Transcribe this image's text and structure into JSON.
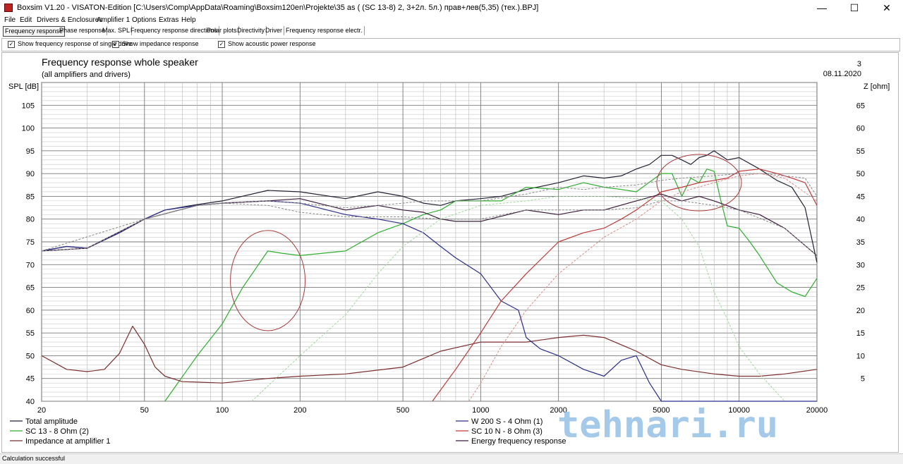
{
  "window": {
    "title": "Boxsim V1.20 - VISATON-Edition [C:\\Users\\Comp\\AppData\\Roaming\\Boxsim120en\\Projekte\\35 as (  (SC 13-8)  2, 3+2л. 5л.)  прав+лев(5,35) (тех.).BPJ]",
    "minimize": "—",
    "maximize": "☐",
    "close": "✕"
  },
  "menu": [
    "File",
    "Edit",
    "Drivers & Enclosures",
    "Amplifier 1",
    "Options",
    "Extras",
    "Help"
  ],
  "tabs": [
    {
      "label": "Frequency response",
      "active": true
    },
    {
      "label": "Phase response",
      "active": false
    },
    {
      "label": "Max. SPL",
      "active": false
    },
    {
      "label": "Frequency response directions",
      "active": false
    },
    {
      "label": "Polar plots",
      "active": false
    },
    {
      "label": "Directivity",
      "active": false
    },
    {
      "label": "Driver",
      "active": false
    },
    {
      "label": "Frequency response electr.",
      "active": false
    }
  ],
  "options": [
    {
      "label": "Show frequency response of single drive",
      "checked": true
    },
    {
      "label": "Show impedance response",
      "checked": true
    },
    {
      "label": "Show acoustic power response",
      "checked": true
    }
  ],
  "status": "Calculation successful",
  "watermark": "tehnari.ru",
  "chart_data": {
    "type": "line",
    "title": "Frequency response whole speaker",
    "subtitle": "(all amplifiers and drivers)",
    "corner_number": "3",
    "date": "08.11.2020",
    "ylabel": "SPL [dB]",
    "y2label": "Z [ohm]",
    "xscale": "log",
    "xlim": [
      20,
      20000
    ],
    "ylim": [
      40,
      110
    ],
    "y2lim": [
      0,
      70
    ],
    "xticks": [
      20,
      50,
      100,
      200,
      500,
      1000,
      2000,
      5000,
      10000,
      20000
    ],
    "yticks": [
      40,
      45,
      50,
      55,
      60,
      65,
      70,
      75,
      80,
      85,
      90,
      95,
      100,
      105
    ],
    "y2ticks": [
      5,
      10,
      15,
      20,
      25,
      30,
      35,
      40,
      45,
      50,
      55,
      60,
      65
    ],
    "grid": true,
    "legend": [
      {
        "label": "Total amplitude",
        "color": "#222233"
      },
      {
        "label": "SC 13 - 8 Ohm (2)",
        "color": "#2fae2f"
      },
      {
        "label": "Impedance at amplifier 1",
        "color": "#7a2e2e"
      },
      {
        "label": "W 200 S - 4 Ohm (1)",
        "color": "#2c2c8c"
      },
      {
        "label": "SC 10 N - 8 Ohm (3)",
        "color": "#c03a3a"
      },
      {
        "label": "Energy frequency response",
        "color": "#3a1a3a"
      }
    ],
    "series": [
      {
        "name": "Total amplitude",
        "color": "#222233",
        "dash": false,
        "x": [
          20,
          25,
          30,
          40,
          50,
          60,
          80,
          100,
          150,
          200,
          300,
          400,
          500,
          600,
          700,
          800,
          1000,
          1200,
          1500,
          2000,
          2500,
          3000,
          3500,
          4000,
          4500,
          5000,
          5500,
          6000,
          6500,
          7000,
          7500,
          8000,
          9000,
          10000,
          12000,
          14000,
          16000,
          18000,
          20000
        ],
        "y": [
          73,
          74,
          73.6,
          77,
          80,
          82,
          83.2,
          84,
          86.3,
          86,
          84.5,
          86,
          85,
          83.5,
          83,
          84,
          84.5,
          85,
          86.5,
          88,
          89.5,
          89,
          89.5,
          91,
          92,
          94,
          94,
          93,
          92,
          93.5,
          94,
          95,
          93,
          93.5,
          91,
          88.5,
          87,
          82.5,
          70.5
        ]
      },
      {
        "name": "SC 13 - 8 Ohm (2)",
        "color": "#2fae2f",
        "dash": false,
        "x": [
          60,
          80,
          100,
          120,
          150,
          170,
          200,
          300,
          400,
          500,
          600,
          700,
          800,
          1000,
          1200,
          1500,
          2000,
          2500,
          3000,
          3500,
          4000,
          5000,
          5500,
          6000,
          6500,
          7000,
          7500,
          8000,
          8500,
          9000,
          10000,
          11000,
          12000,
          14000,
          16000,
          18000,
          20000
        ],
        "y": [
          40,
          50,
          57,
          65,
          73,
          72.5,
          72,
          73,
          77,
          79,
          81,
          82,
          84,
          84,
          84,
          87,
          86.5,
          88,
          87,
          86.5,
          86,
          90,
          90,
          85,
          89,
          88,
          91,
          90.5,
          84,
          78.5,
          78,
          75,
          72,
          66,
          64,
          63,
          67
        ]
      },
      {
        "name": "Impedance at amplifier 1",
        "color": "#7a2e2e",
        "dash": false,
        "axis": "right",
        "x": [
          20,
          25,
          30,
          35,
          40,
          45,
          50,
          55,
          60,
          70,
          80,
          100,
          150,
          200,
          300,
          500,
          700,
          1000,
          1500,
          2000,
          2500,
          3000,
          4000,
          5000,
          6000,
          8000,
          10000,
          12000,
          15000,
          20000
        ],
        "y": [
          10,
          7,
          6.5,
          7,
          10.5,
          16.5,
          12.5,
          7.5,
          5.5,
          4.3,
          4.2,
          4,
          5,
          5.5,
          6,
          7.5,
          11,
          13,
          13,
          14,
          14.5,
          14,
          11,
          8,
          7,
          6,
          5.5,
          5.5,
          6,
          7
        ]
      },
      {
        "name": "W 200 S - 4 Ohm (1)",
        "color": "#2c2c8c",
        "dash": false,
        "x": [
          20,
          25,
          30,
          40,
          50,
          60,
          80,
          100,
          150,
          200,
          300,
          400,
          500,
          600,
          700,
          800,
          1000,
          1200,
          1400,
          1500,
          1700,
          2000,
          2500,
          3000,
          3500,
          4000,
          4500,
          5000,
          10000,
          20000
        ],
        "y": [
          73,
          74,
          73.6,
          77,
          80,
          82,
          83,
          83.5,
          84,
          83.5,
          81,
          80,
          79,
          77,
          74,
          71.5,
          68,
          62,
          60,
          54,
          51.5,
          50,
          47,
          45.5,
          49,
          50,
          44,
          40,
          40,
          40
        ]
      },
      {
        "name": "SC 10 N - 8 Ohm (3)",
        "color": "#c03a3a",
        "dash": false,
        "x": [
          650,
          800,
          1000,
          1200,
          1500,
          2000,
          2500,
          3000,
          3500,
          4000,
          5000,
          6000,
          7000,
          8000,
          9000,
          10000,
          12000,
          14000,
          16000,
          18000,
          20000
        ],
        "y": [
          40,
          47,
          55,
          62,
          68,
          75,
          77,
          78,
          80,
          82,
          86,
          87,
          88,
          88.5,
          89,
          90.5,
          91,
          90,
          89,
          88,
          83
        ]
      },
      {
        "name": "Energy frequency response",
        "color": "#3a1a3a",
        "dash": false,
        "x": [
          20,
          30,
          50,
          80,
          100,
          150,
          200,
          300,
          400,
          500,
          600,
          700,
          800,
          1000,
          1500,
          2000,
          2500,
          3000,
          4000,
          5000,
          6000,
          7000,
          8000,
          10000,
          12000,
          15000,
          20000
        ],
        "y": [
          73,
          73.6,
          80,
          83,
          83.5,
          84,
          84.5,
          82,
          83,
          82,
          81.5,
          80,
          79.5,
          79.5,
          82,
          81,
          82,
          82,
          84,
          85.5,
          84,
          85,
          84,
          82,
          81,
          78,
          72
        ]
      },
      {
        "name": "",
        "color": "#888888",
        "dash": true,
        "x": [
          20,
          30,
          50,
          80,
          100,
          150,
          200,
          300,
          400,
          500,
          600,
          800,
          1000,
          1500,
          2000,
          2500,
          3000,
          4000,
          5000,
          6000,
          8000,
          10000,
          12000,
          15000,
          18000,
          20000
        ],
        "y": [
          73,
          73.6,
          80,
          83,
          83.5,
          84,
          83.5,
          82.5,
          83,
          83.5,
          84,
          84,
          84,
          85.5,
          87,
          86.5,
          87,
          87.5,
          88.5,
          89,
          89.5,
          90,
          90,
          89.5,
          89,
          85
        ]
      },
      {
        "name": "",
        "color": "#888888",
        "dash": true,
        "x": [
          20,
          50,
          80,
          100,
          150,
          200,
          300,
          500,
          700,
          1000,
          1500,
          2000,
          3000,
          4000,
          5000,
          6000,
          8000,
          10000,
          15000,
          20000
        ],
        "y": [
          73,
          80,
          83,
          83.5,
          83,
          81.5,
          80.5,
          80.5,
          80,
          80,
          82,
          82,
          82,
          82.5,
          84,
          84,
          83,
          82,
          78,
          72
        ]
      },
      {
        "name": "",
        "color": "#9fd89f",
        "dash": true,
        "x": [
          130,
          200,
          300,
          400,
          500,
          700,
          1000,
          1500,
          2000,
          3000,
          4000,
          5000,
          6000,
          7000,
          8000,
          9000,
          10000,
          12000,
          15000
        ],
        "y": [
          40,
          50,
          59,
          68,
          74,
          80,
          83,
          84,
          85,
          85,
          84.5,
          84,
          80,
          74,
          64,
          58,
          52,
          46,
          40
        ]
      },
      {
        "name": "",
        "color": "#dd8a8a",
        "dash": true,
        "x": [
          900,
          1000,
          1200,
          1500,
          2000,
          3000,
          4000,
          5000,
          6000,
          8000,
          10000,
          12000,
          15000,
          20000
        ],
        "y": [
          40,
          44,
          52,
          60,
          68,
          76,
          80,
          84,
          86,
          88,
          89.5,
          90,
          89,
          84
        ]
      }
    ]
  }
}
